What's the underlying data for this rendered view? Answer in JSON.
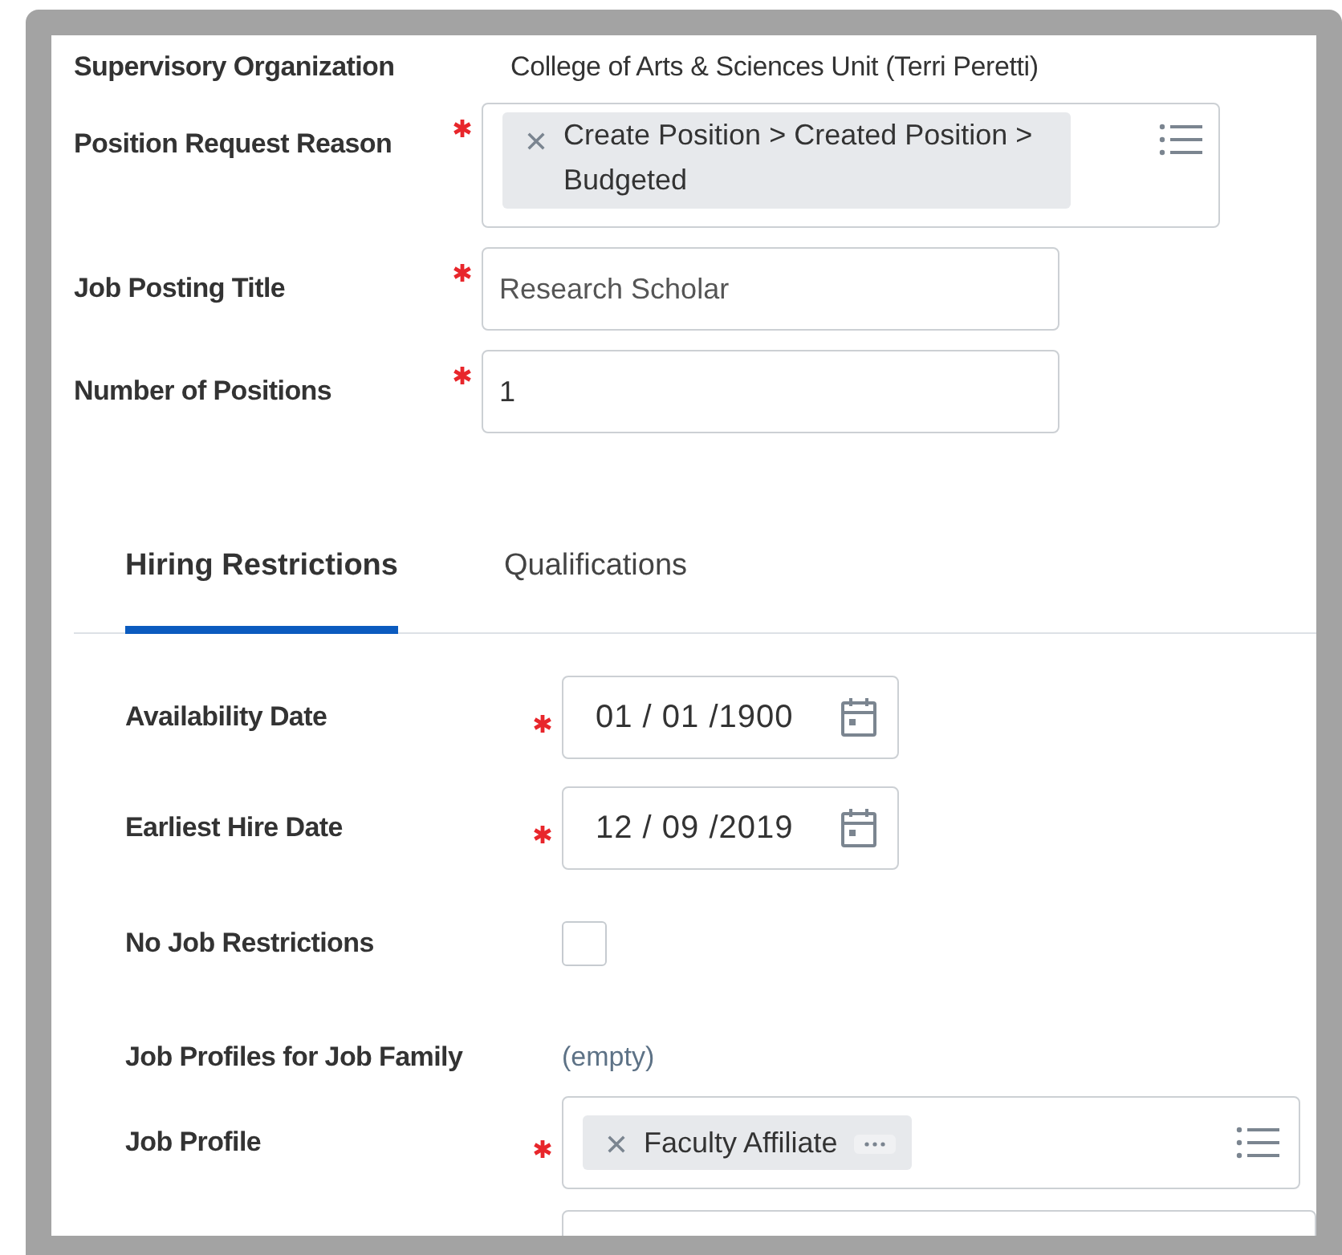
{
  "top_fields": [
    {
      "label": "Supervisory Organization",
      "required": false,
      "kind": "text",
      "value": "College of Arts & Sciences Unit (Terri Peretti)"
    },
    {
      "label": "Position Request Reason",
      "required": true,
      "kind": "multiselect",
      "chips": [
        {
          "label": "Create Position > Created Position > Budgeted",
          "more": false
        }
      ]
    },
    {
      "label": "Job Posting Title",
      "required": true,
      "kind": "input",
      "value": "Research Scholar"
    },
    {
      "label": "Number of Positions",
      "required": true,
      "kind": "input",
      "value": "1"
    }
  ],
  "tabs": [
    {
      "label": "Hiring Restrictions",
      "selected": true
    },
    {
      "label": "Qualifications",
      "selected": false
    }
  ],
  "tab_fields": [
    {
      "label": "Availability Date",
      "required": true,
      "kind": "date",
      "value": "01 / 01 /1900"
    },
    {
      "label": "Earliest Hire Date",
      "required": true,
      "kind": "date",
      "value": "12 / 09 /2019"
    },
    {
      "label": "No Job Restrictions",
      "required": false,
      "kind": "checkbox",
      "checked": false
    },
    {
      "label": "Job Profiles for Job Family",
      "required": false,
      "kind": "empty",
      "value": "(empty)"
    },
    {
      "label": "Job Profile",
      "required": true,
      "kind": "multiselect",
      "chips": [
        {
          "label": "Faculty Affiliate",
          "more": true
        }
      ]
    },
    {
      "required": false,
      "kind": "cutoff"
    }
  ]
}
